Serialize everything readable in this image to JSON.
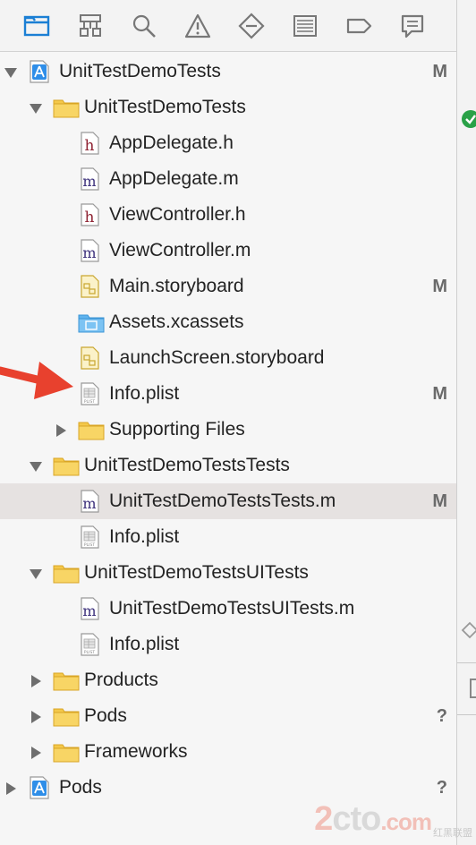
{
  "navigator": {
    "tabs": [
      {
        "icon": "folder-icon",
        "active": true
      },
      {
        "icon": "hierarchy-icon"
      },
      {
        "icon": "search-icon"
      },
      {
        "icon": "warning-icon"
      },
      {
        "icon": "test-diamond-icon"
      },
      {
        "icon": "debug-list-icon"
      },
      {
        "icon": "breakpoint-icon"
      },
      {
        "icon": "report-icon"
      }
    ]
  },
  "tree": [
    {
      "label": "UnitTestDemoTests",
      "icon": "project-icon",
      "expanded": true,
      "badge": "M"
    },
    {
      "label": "UnitTestDemoTests",
      "icon": "folder-icon",
      "expanded": true,
      "badge": ""
    },
    {
      "label": "AppDelegate.h",
      "icon": "header-file-icon",
      "badge": ""
    },
    {
      "label": "AppDelegate.m",
      "icon": "source-file-icon",
      "badge": ""
    },
    {
      "label": "ViewController.h",
      "icon": "header-file-icon",
      "badge": ""
    },
    {
      "label": "ViewController.m",
      "icon": "source-file-icon",
      "badge": ""
    },
    {
      "label": "Main.storyboard",
      "icon": "storyboard-icon",
      "badge": "M"
    },
    {
      "label": "Assets.xcassets",
      "icon": "assets-folder-icon",
      "badge": ""
    },
    {
      "label": "LaunchScreen.storyboard",
      "icon": "storyboard-icon",
      "badge": ""
    },
    {
      "label": "Info.plist",
      "icon": "plist-icon",
      "badge": "M"
    },
    {
      "label": "Supporting Files",
      "icon": "folder-icon",
      "expanded": false,
      "badge": ""
    },
    {
      "label": "UnitTestDemoTestsTests",
      "icon": "folder-icon",
      "expanded": true,
      "badge": ""
    },
    {
      "label": "UnitTestDemoTestsTests.m",
      "icon": "source-file-icon",
      "badge": "M",
      "selected": true
    },
    {
      "label": "Info.plist",
      "icon": "plist-icon",
      "badge": ""
    },
    {
      "label": "UnitTestDemoTestsUITests",
      "icon": "folder-icon",
      "expanded": true,
      "badge": ""
    },
    {
      "label": "UnitTestDemoTestsUITests.m",
      "icon": "source-file-icon",
      "badge": ""
    },
    {
      "label": "Info.plist",
      "icon": "plist-icon",
      "badge": ""
    },
    {
      "label": "Products",
      "icon": "folder-icon",
      "expanded": false,
      "badge": ""
    },
    {
      "label": "Pods",
      "icon": "folder-icon",
      "expanded": false,
      "badge": "?"
    },
    {
      "label": "Frameworks",
      "icon": "folder-icon",
      "expanded": false,
      "badge": ""
    },
    {
      "label": "Pods",
      "icon": "project-icon",
      "expanded": false,
      "badge": "?"
    }
  ],
  "watermark": {
    "main_a": "2",
    "main_b": "cto",
    "main_c": ".com",
    "side": "红黑联盟"
  },
  "colors": {
    "accent": "#1b7fd4",
    "folder": "#f4c84a",
    "selection": "#e6e2e1",
    "arrow": "#e8412e",
    "check": "#2aa147"
  }
}
